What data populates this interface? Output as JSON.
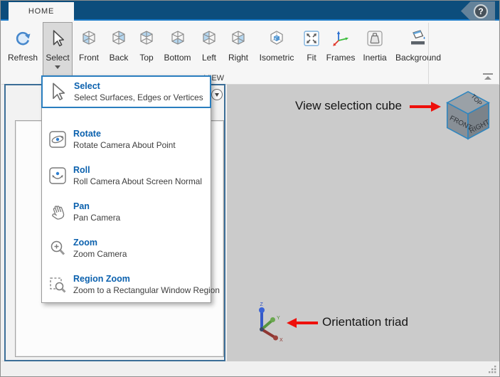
{
  "window": {
    "help_label": "?"
  },
  "tabs": [
    {
      "label": "HOME"
    }
  ],
  "ribbon": {
    "section_label": "VIEW",
    "buttons": [
      {
        "label": "Refresh",
        "icon": "refresh-icon"
      },
      {
        "label": "Select",
        "icon": "cursor-icon",
        "pressed": true,
        "has_dropdown": true
      },
      {
        "label": "Front",
        "icon": "cube-front-icon"
      },
      {
        "label": "Back",
        "icon": "cube-back-icon"
      },
      {
        "label": "Top",
        "icon": "cube-top-icon"
      },
      {
        "label": "Bottom",
        "icon": "cube-bottom-icon"
      },
      {
        "label": "Left",
        "icon": "cube-left-icon"
      },
      {
        "label": "Right",
        "icon": "cube-right-icon"
      },
      {
        "label": "Isometric",
        "icon": "isometric-icon"
      },
      {
        "label": "Fit",
        "icon": "fit-icon"
      },
      {
        "label": "Frames",
        "icon": "frames-icon"
      },
      {
        "label": "Inertia",
        "icon": "inertia-icon"
      },
      {
        "label": "Background",
        "icon": "background-icon"
      }
    ]
  },
  "menu": {
    "items": [
      {
        "title": "Select",
        "description": "Select Surfaces, Edges or Vertices",
        "icon": "cursor-icon",
        "selected": true
      },
      {
        "title": "Rotate",
        "description": "Rotate Camera About Point",
        "icon": "rotate-icon"
      },
      {
        "title": "Roll",
        "description": "Roll Camera About Screen Normal",
        "icon": "roll-icon"
      },
      {
        "title": "Pan",
        "description": "Pan Camera",
        "icon": "pan-icon"
      },
      {
        "title": "Zoom",
        "description": "Zoom Camera",
        "icon": "zoom-icon"
      },
      {
        "title": "Region Zoom",
        "description": "Zoom to a Rectangular Window Region",
        "icon": "region-zoom-icon"
      }
    ]
  },
  "viewport": {
    "annotations": [
      {
        "text": "View selection cube",
        "arrow": "right"
      },
      {
        "text": "Orientation triad",
        "arrow": "left"
      }
    ],
    "view_cube": {
      "faces": [
        "TOP",
        "FRONT",
        "RIGHT"
      ]
    },
    "triad": {
      "labels": {
        "z": "Z",
        "y": "Y",
        "x": "X"
      }
    }
  },
  "colors": {
    "navy": "#0c4d7c",
    "accent_blue": "#1878c8",
    "panel_border_blue": "#3c6e97",
    "menu_title_blue": "#0b61ae",
    "annotation_red": "#ee100b",
    "viewport_gray": "#cbcbcb",
    "cube_face_highlight": "#b5d7f0"
  }
}
